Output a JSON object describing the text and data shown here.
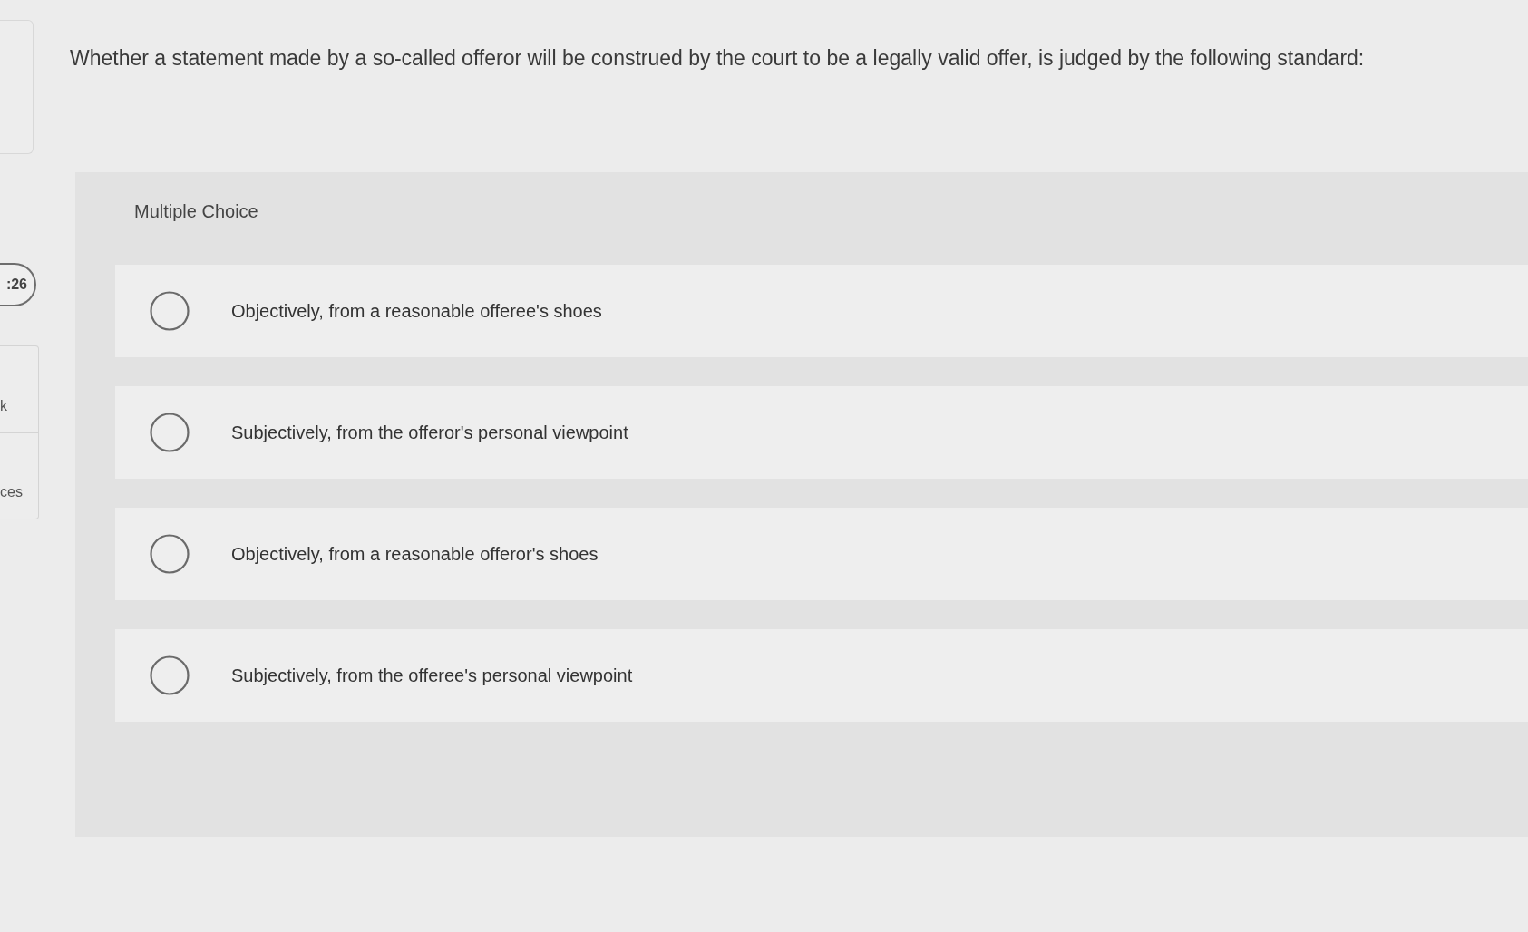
{
  "sidebar": {
    "timer": ":26",
    "items": [
      {
        "label": "k"
      },
      {
        "label": "ces"
      }
    ]
  },
  "question": {
    "prompt": "Whether a statement made by a so-called offeror will be construed by the court to be a legally valid offer, is judged by the following standard:",
    "type_label": "Multiple Choice",
    "options": [
      {
        "text": "Objectively, from a reasonable offeree's shoes",
        "selected": false
      },
      {
        "text": "Subjectively, from the offeror's personal viewpoint",
        "selected": false
      },
      {
        "text": "Objectively, from a reasonable offeror's shoes",
        "selected": false
      },
      {
        "text": "Subjectively, from the offeree's personal viewpoint",
        "selected": false
      }
    ]
  }
}
